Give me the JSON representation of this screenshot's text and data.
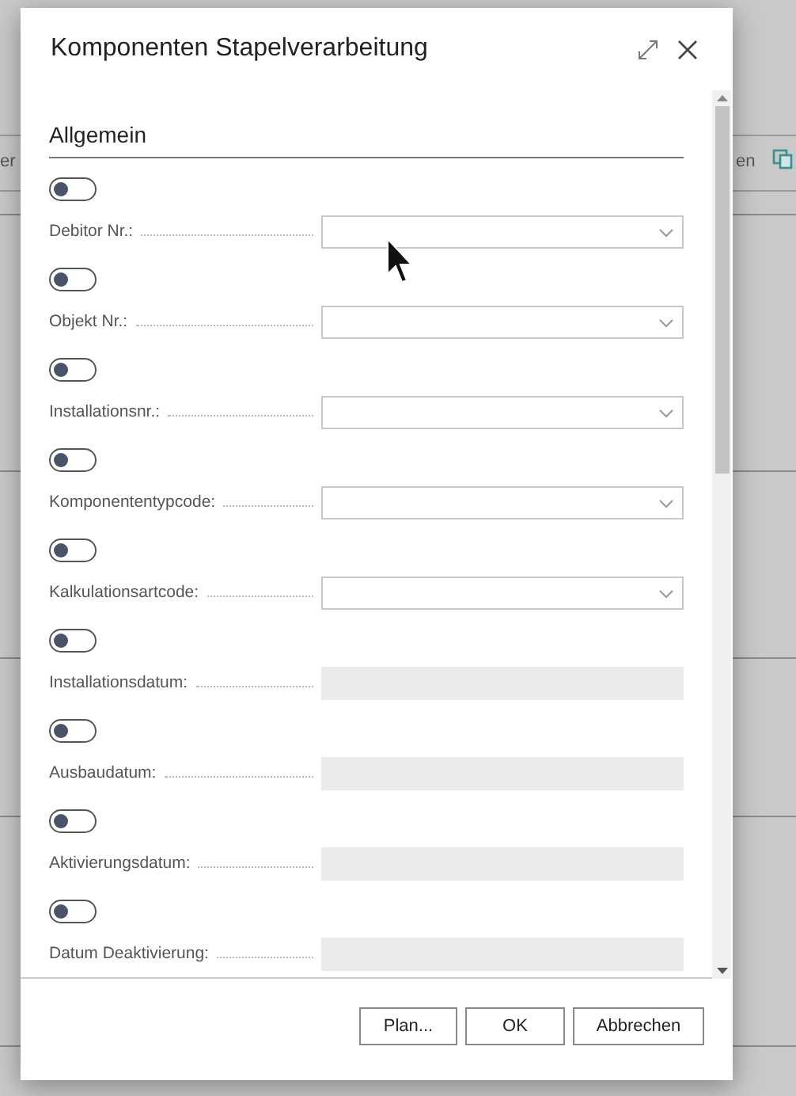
{
  "background": {
    "left_fragment": "er",
    "right_fragment": "en"
  },
  "dialog": {
    "title": "Komponenten Stapelverarbeitung"
  },
  "section": {
    "title": "Allgemein"
  },
  "rows": [
    {
      "label": "Debitor Nr.:",
      "kind": "dropdown",
      "toggle_on": false
    },
    {
      "label": "Objekt Nr.:",
      "kind": "dropdown",
      "toggle_on": false
    },
    {
      "label": "Installationsnr.:",
      "kind": "dropdown",
      "toggle_on": false
    },
    {
      "label": "Komponententypcode:",
      "kind": "dropdown",
      "toggle_on": false
    },
    {
      "label": "Kalkulationsartcode:",
      "kind": "dropdown",
      "toggle_on": false
    },
    {
      "label": "Installationsdatum:",
      "kind": "date",
      "toggle_on": false
    },
    {
      "label": "Ausbaudatum:",
      "kind": "date",
      "toggle_on": false
    },
    {
      "label": "Aktivierungsdatum:",
      "kind": "date",
      "toggle_on": false
    },
    {
      "label": "Datum Deaktivierung:",
      "kind": "date",
      "toggle_on": false
    }
  ],
  "buttons": [
    {
      "label": "Plan..."
    },
    {
      "label": "OK"
    },
    {
      "label": "Abbrechen"
    }
  ]
}
